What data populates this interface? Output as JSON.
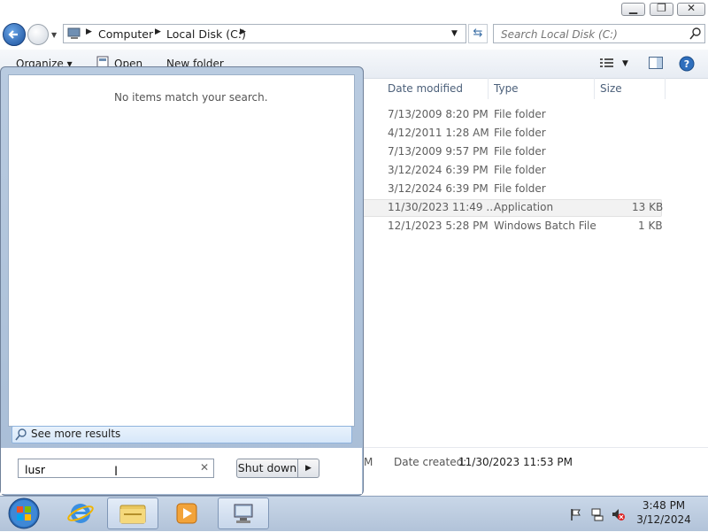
{
  "window": {
    "minimize_glyph": "▁",
    "maximize_glyph": "❐",
    "close_glyph": "✕"
  },
  "address": {
    "crumbs": [
      "Computer",
      "Local Disk (C:)"
    ],
    "search_placeholder": "Search Local Disk (C:)"
  },
  "toolbar": {
    "organize": "Organize ▾",
    "open": "Open",
    "new_folder": "New folder"
  },
  "columns": {
    "date_modified": "Date modified",
    "type": "Type",
    "size": "Size"
  },
  "files": [
    {
      "date": "7/13/2009 8:20 PM",
      "type": "File folder",
      "size": ""
    },
    {
      "date": "4/12/2011 1:28 AM",
      "type": "File folder",
      "size": ""
    },
    {
      "date": "7/13/2009 9:57 PM",
      "type": "File folder",
      "size": ""
    },
    {
      "date": "3/12/2024 6:39 PM",
      "type": "File folder",
      "size": ""
    },
    {
      "date": "3/12/2024 6:39 PM",
      "type": "File folder",
      "size": ""
    },
    {
      "date": "11/30/2023 11:49 ...",
      "type": "Application",
      "size": "13 KB"
    },
    {
      "date": "12/1/2023 5:28 PM",
      "type": "Windows Batch File",
      "size": "1 KB"
    }
  ],
  "details": {
    "fragment": "M",
    "date_created_label": "Date created:",
    "date_created_value": "11/30/2023 11:53 PM"
  },
  "start_menu": {
    "no_results": "No items match your search.",
    "see_more": "See more results",
    "search_value": "lusr",
    "shutdown_label": "Shut down",
    "shutdown_arrow": "▶"
  },
  "taskbar": {
    "time": "3:48 PM",
    "date": "3/12/2024"
  },
  "colors": {
    "start_menu_frame": "#a8bdd6",
    "taskbar": "#b2c3d9",
    "accent": "#3a6ea5"
  }
}
